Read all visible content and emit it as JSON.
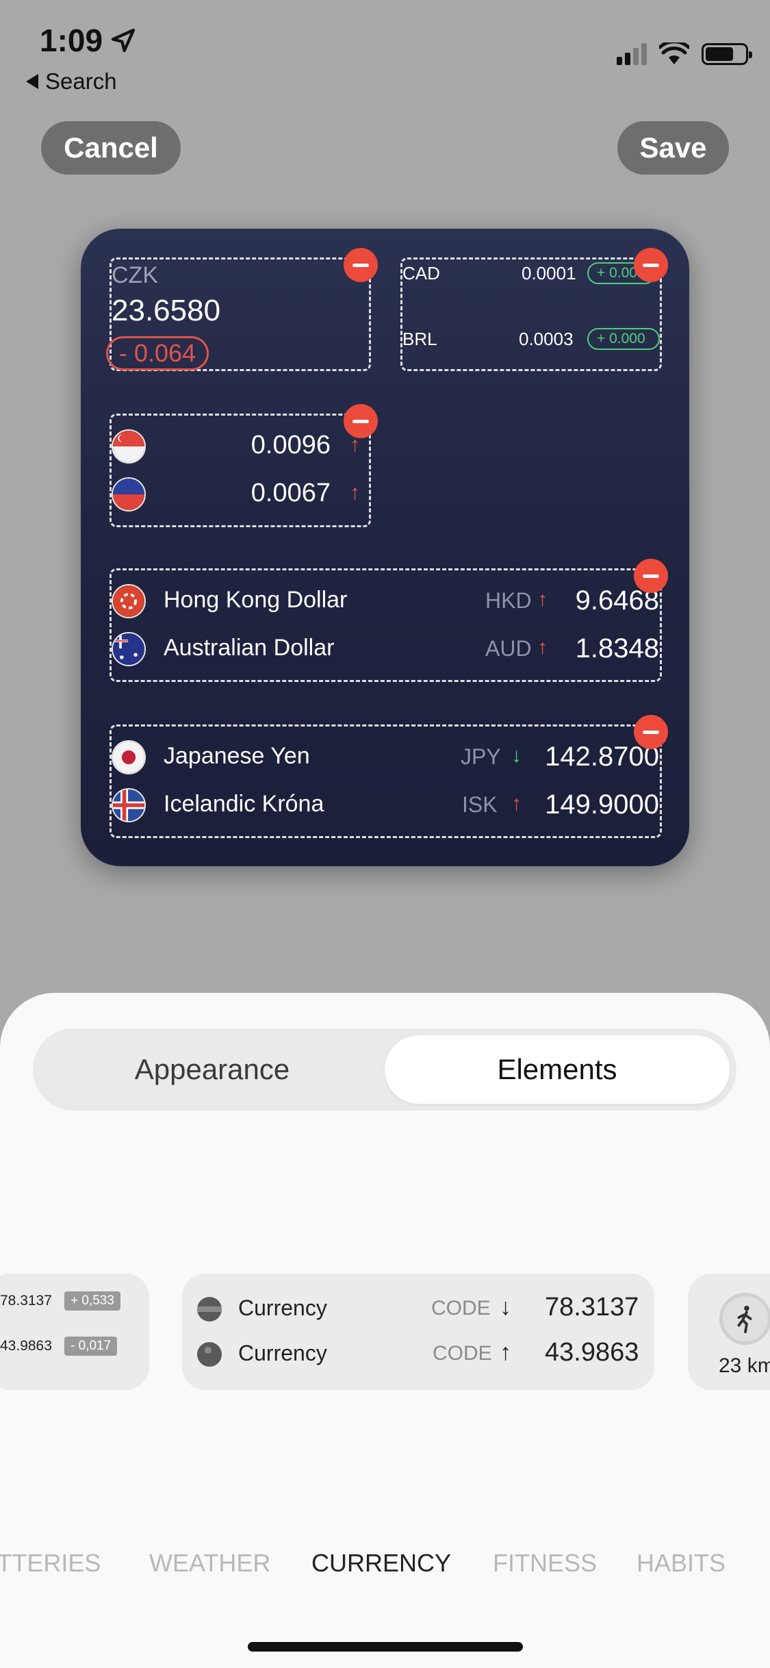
{
  "status": {
    "time": "1:09",
    "back_label": "Search"
  },
  "header": {
    "cancel_label": "Cancel",
    "save_label": "Save"
  },
  "widget": {
    "czk": {
      "code": "CZK",
      "value": "23.6580",
      "change": "- 0.064"
    },
    "mini_rows": [
      {
        "code": "CAD",
        "value": "0.0001",
        "change": "+ 0.00"
      },
      {
        "code": "BRL",
        "value": "0.0003",
        "change": "+ 0.000"
      }
    ],
    "flag_rows": [
      {
        "value": "0.0096",
        "trend": "↑"
      },
      {
        "value": "0.0067",
        "trend": "↑"
      }
    ],
    "group1": [
      {
        "name": "Hong Kong Dollar",
        "code": "HKD",
        "trend": "↑",
        "value": "9.6468"
      },
      {
        "name": "Australian Dollar",
        "code": "AUD",
        "trend": "↑",
        "value": "1.8348"
      }
    ],
    "group2": [
      {
        "name": "Japanese Yen",
        "code": "JPY",
        "trend": "↓",
        "value": "142.8700"
      },
      {
        "name": "Icelandic Króna",
        "code": "ISK",
        "trend": "↑",
        "value": "149.9000"
      }
    ]
  },
  "sheet": {
    "tabs": {
      "appearance": "Appearance",
      "elements": "Elements",
      "selected": "Elements"
    },
    "card_left": [
      {
        "value": "78.3137",
        "badge": "+ 0,533"
      },
      {
        "value": "43.9863",
        "badge": "- 0,017"
      }
    ],
    "card_mid": [
      {
        "name": "Currency",
        "code": "CODE",
        "trend": "↓",
        "value": "78.3137"
      },
      {
        "name": "Currency",
        "code": "CODE",
        "trend": "↑",
        "value": "43.9863"
      }
    ],
    "card_right": {
      "distance": "23 km"
    },
    "categories": [
      "BATTERIES",
      "WEATHER",
      "CURRENCY",
      "FITNESS",
      "HABITS"
    ],
    "selected_category": "CURRENCY"
  },
  "colors": {
    "accent_red": "#ec4a3b",
    "up": "#e0544a",
    "down": "#4dd07a",
    "widget_bg": "#1f2440"
  }
}
